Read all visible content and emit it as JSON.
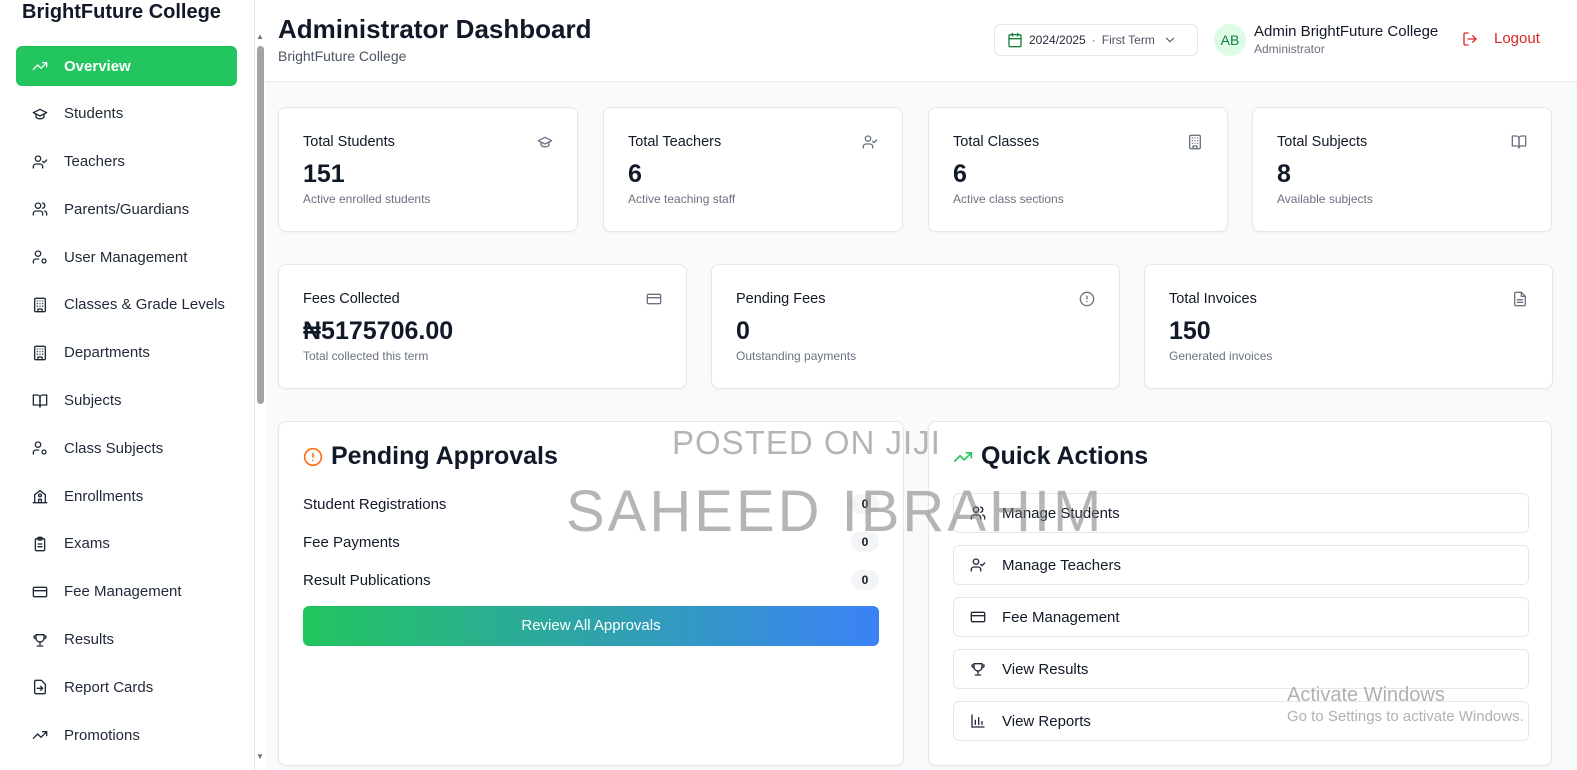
{
  "sidebar": {
    "brand": "BrightFuture College",
    "items": [
      {
        "label": "Overview",
        "icon": "trending-up-icon",
        "active": true
      },
      {
        "label": "Students",
        "icon": "graduation-cap-icon"
      },
      {
        "label": "Teachers",
        "icon": "user-check-icon"
      },
      {
        "label": "Parents/Guardians",
        "icon": "users-icon"
      },
      {
        "label": "User Management",
        "icon": "user-cog-icon"
      },
      {
        "label": "Classes & Grade Levels",
        "icon": "building-icon"
      },
      {
        "label": "Departments",
        "icon": "building-icon"
      },
      {
        "label": "Subjects",
        "icon": "book-open-icon"
      },
      {
        "label": "Class Subjects",
        "icon": "user-cog-icon"
      },
      {
        "label": "Enrollments",
        "icon": "school-icon"
      },
      {
        "label": "Exams",
        "icon": "clipboard-icon"
      },
      {
        "label": "Fee Management",
        "icon": "credit-card-icon"
      },
      {
        "label": "Results",
        "icon": "trophy-icon"
      },
      {
        "label": "Report Cards",
        "icon": "file-export-icon"
      },
      {
        "label": "Promotions",
        "icon": "trending-up-icon"
      }
    ]
  },
  "header": {
    "title": "Administrator Dashboard",
    "subtitle": "BrightFuture College",
    "session": {
      "year": "2024/2025",
      "separator": "·",
      "term": "First Term"
    },
    "user": {
      "initials": "AB",
      "name": "Admin BrightFuture College",
      "role": "Administrator"
    },
    "logout_label": "Logout"
  },
  "stats_row1": [
    {
      "label": "Total Students",
      "value": "151",
      "desc": "Active enrolled students",
      "icon": "graduation-cap-icon"
    },
    {
      "label": "Total Teachers",
      "value": "6",
      "desc": "Active teaching staff",
      "icon": "user-check-icon"
    },
    {
      "label": "Total Classes",
      "value": "6",
      "desc": "Active class sections",
      "icon": "building-icon"
    },
    {
      "label": "Total Subjects",
      "value": "8",
      "desc": "Available subjects",
      "icon": "book-open-icon"
    }
  ],
  "stats_row2": [
    {
      "label": "Fees Collected",
      "value": "₦5175706.00",
      "desc": "Total collected this term",
      "icon": "credit-card-icon"
    },
    {
      "label": "Pending Fees",
      "value": "0",
      "desc": "Outstanding payments",
      "icon": "alert-circle-icon"
    },
    {
      "label": "Total Invoices",
      "value": "150",
      "desc": "Generated invoices",
      "icon": "file-text-icon"
    }
  ],
  "pending": {
    "title": "Pending Approvals",
    "rows": [
      {
        "label": "Student Registrations",
        "count": "0"
      },
      {
        "label": "Fee Payments",
        "count": "0"
      },
      {
        "label": "Result Publications",
        "count": "0"
      }
    ],
    "button": "Review All Approvals"
  },
  "quick": {
    "title": "Quick Actions",
    "actions": [
      {
        "label": "Manage Students",
        "icon": "users-icon"
      },
      {
        "label": "Manage Teachers",
        "icon": "user-check-icon"
      },
      {
        "label": "Fee Management",
        "icon": "credit-card-icon"
      },
      {
        "label": "View Results",
        "icon": "trophy-icon"
      },
      {
        "label": "View Reports",
        "icon": "bar-chart-icon"
      }
    ]
  },
  "overlays": {
    "watermark_line1": "POSTED ON JIJI",
    "watermark_line2": "SAHEED IBRAHIM",
    "activate_title": "Activate Windows",
    "activate_sub": "Go to Settings to activate Windows."
  },
  "colors": {
    "accent": "#22c55e",
    "gradient_end": "#3b82f6",
    "danger": "#dc2626",
    "warning": "#f97316"
  }
}
